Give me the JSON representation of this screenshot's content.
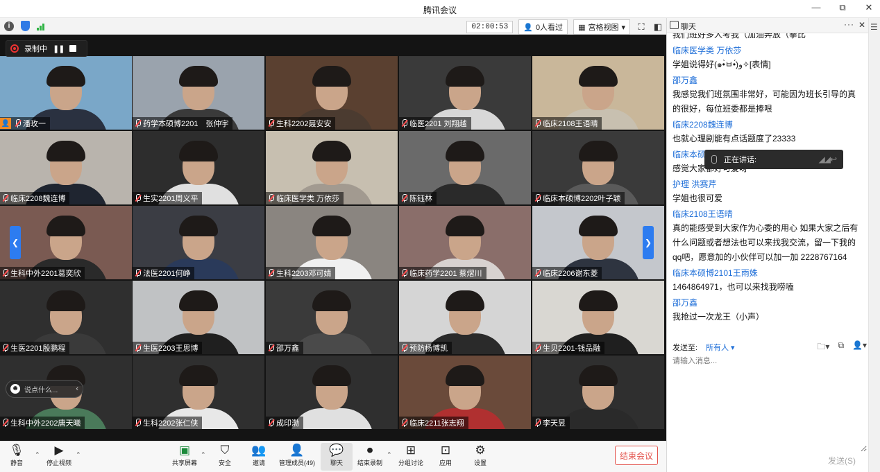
{
  "window": {
    "title": "腾讯会议",
    "controls": [
      "—",
      "⧉",
      "✕"
    ]
  },
  "status": {
    "timer": "02:00:53",
    "viewers": "0人看过",
    "view_mode": "宫格视图"
  },
  "recording": {
    "label": "录制中"
  },
  "tiles": [
    {
      "name": "潘玫一",
      "host": true,
      "bg": "#7aa7c8",
      "shirt": "#2a3140"
    },
    {
      "name": "药学本硕博2201　张仲宇",
      "bg": "#9aa3ad",
      "shirt": "#3a3a3a"
    },
    {
      "name": "生科2202聂安安",
      "bg": "#5a4030",
      "shirt": "#4b3b30"
    },
    {
      "name": "临医2201 刘翔越",
      "bg": "#3a3a3a",
      "shirt": "#d8d8d8"
    },
    {
      "name": "临床2108王语晴",
      "bg": "#c9b79a",
      "shirt": "#c8c0b0"
    },
    {
      "name": "临床2208魏连博",
      "bg": "#b9b4ad",
      "shirt": "#1f2530"
    },
    {
      "name": "生实2201周义平",
      "bg": "#2d2d2d",
      "shirt": "#e0e0e0"
    },
    {
      "name": "临床医学类 万依莎",
      "bg": "#c7bfb0",
      "shirt": "#a29a90"
    },
    {
      "name": "陈钰林",
      "bg": "#6a6a6a",
      "shirt": "#2a2a2a"
    },
    {
      "name": "临床本硕博2202叶子颖",
      "bg": "#3a3a3a",
      "shirt": "#5a5a5a"
    },
    {
      "name": "生科中外2201葛奕欣",
      "bg": "#7a5a52",
      "shirt": "#2a2a2a"
    },
    {
      "name": "法医2201何峥",
      "bg": "#3b3d44",
      "shirt": "#2a3a5a"
    },
    {
      "name": "生科2203邓可婧",
      "bg": "#8a8580",
      "shirt": "#f0f0f0"
    },
    {
      "name": "临床药学2201 蔡熠川",
      "bg": "#8a6e6a",
      "shirt": "#d8d2d0"
    },
    {
      "name": "临床2206谢东菱",
      "bg": "#c4c7cc",
      "shirt": "#2e3440"
    },
    {
      "name": "生医2201殷鹏程",
      "bg": "#2f2f2f",
      "shirt": "#3a3a3a"
    },
    {
      "name": "生医2203王思博",
      "bg": "#c0c2c4",
      "shirt": "#1f1f1f"
    },
    {
      "name": "邵万鑫",
      "bg": "#3a3a3a",
      "shirt": "#4a4a4a"
    },
    {
      "name": "预防杨博凯",
      "bg": "#d5d5d5",
      "shirt": "#2a2a2a"
    },
    {
      "name": "生贝2201-钱品融",
      "bg": "#d9d7d2",
      "shirt": "#1f1f1f"
    },
    {
      "name": "生科中外2202唐天曦",
      "bg": "#2f2f2f",
      "shirt": "#4a7a5a"
    },
    {
      "name": "生科2202张仁侠",
      "bg": "#2f2f2f",
      "shirt": "#e8e8e8"
    },
    {
      "name": "成印渤",
      "bg": "#2f2f2f",
      "shirt": "#e0e0e0"
    },
    {
      "name": "临床2211张志翔",
      "bg": "#6a4a3a",
      "shirt": "#b03030"
    },
    {
      "name": "李天昱",
      "bg": "#2f2f2f",
      "shirt": "#2a2a2a"
    }
  ],
  "say_placeholder": "说点什么...",
  "toolbar": {
    "mute": "静音",
    "stop_video": "停止视频",
    "share": "共享屏幕",
    "security": "安全",
    "invite": "邀请",
    "manage": "管理成员(49)",
    "chat": "聊天",
    "end_record": "结束录制",
    "breakout": "分组讨论",
    "apps": "应用",
    "settings": "设置",
    "end_meeting": "结束会议"
  },
  "chat": {
    "title": "聊天",
    "messages": [
      {
        "text": "我们班好多人考我（加油奔放（拳比",
        "clip": true
      },
      {
        "name": "临床医学类 万依莎",
        "text": "学姐说得好(๑•̀ㅂ•́)و✧[表情]"
      },
      {
        "name": "邵万鑫",
        "text": "我感觉我们班氛围非常好，可能因为班长引导的真的很好，每位班委都是捧哏"
      },
      {
        "name": "临床2208魏连博",
        "text": "也就心理剧能有点话题度了23333"
      },
      {
        "name": "临床本硕博2202叶子颖",
        "text": "感觉大家都好可爱呀"
      },
      {
        "name": "护理 洪赛芹",
        "text": "学姐也很可爱"
      },
      {
        "name": "临床2108王语晴",
        "text": "真的能感受到大家作为心委的用心 如果大家之后有什么问题或者想法也可以来找我交流，留一下我的qq吧，愿意加的小伙伴可以加一加 2228767164"
      },
      {
        "name": "临床本硕博2101王雨姝",
        "text": "1464864971，也可以来找我唠嗑"
      },
      {
        "name": "邵万鑫",
        "text": "我抢过一次龙王（小声）"
      }
    ],
    "speaking_label": "正在讲话:",
    "send_to_label": "发送至:",
    "send_to_target": "所有人",
    "input_placeholder": "请输入消息...",
    "send_button": "发送(S)"
  },
  "colors": {
    "accent": "#1e6ed8",
    "danger": "#e3544d",
    "video_bg": "#141414"
  }
}
